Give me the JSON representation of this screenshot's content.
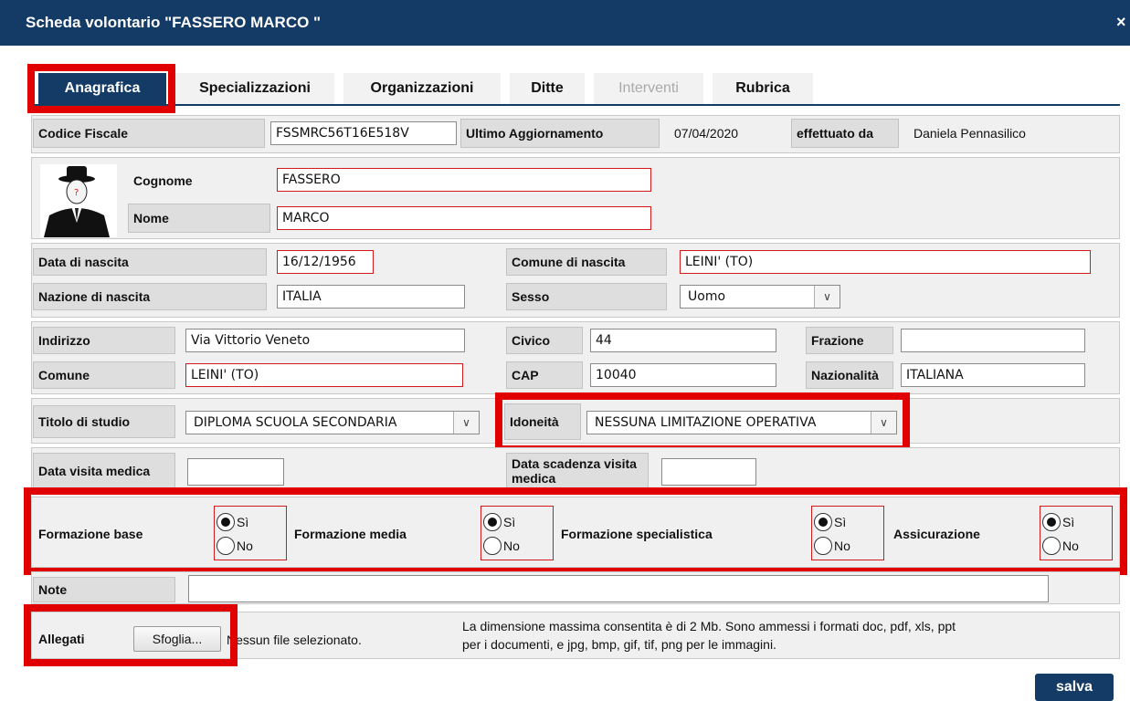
{
  "window": {
    "title": "Scheda volontario \"FASSERO MARCO \"",
    "close_label": "×"
  },
  "tabs": [
    {
      "label": "Anagrafica"
    },
    {
      "label": "Specializzazioni"
    },
    {
      "label": "Organizzazioni"
    },
    {
      "label": "Ditte"
    },
    {
      "label": "Interventi"
    },
    {
      "label": "Rubrica"
    }
  ],
  "header": {
    "codice_fiscale_label": "Codice Fiscale",
    "codice_fiscale_value": "FSSMRC56T16E518V",
    "ultimo_label": "Ultimo Aggiornamento",
    "ultimo_value": "07/04/2020",
    "effettuato_label": "effettuato da",
    "effettuato_value": "Daniela Pennasilico"
  },
  "person": {
    "cognome_label": "Cognome",
    "cognome_value": "FASSERO",
    "nome_label": "Nome",
    "nome_value": "MARCO"
  },
  "birth": {
    "data_label": "Data di nascita",
    "data_value": "16/12/1956",
    "comune_label": "Comune di nascita",
    "comune_value": "LEINI' (TO)",
    "nazione_label": "Nazione di nascita",
    "nazione_value": "ITALIA",
    "sesso_label": "Sesso",
    "sesso_value": "Uomo"
  },
  "address": {
    "indirizzo_label": "Indirizzo",
    "indirizzo_value": "Via Vittorio Veneto",
    "civico_label": "Civico",
    "civico_value": "44",
    "frazione_label": "Frazione",
    "frazione_value": "",
    "comune_label": "Comune",
    "comune_value": "LEINI' (TO)",
    "cap_label": "CAP",
    "cap_value": "10040",
    "nazionalita_label": "Nazionalità",
    "nazionalita_value": "ITALIANA"
  },
  "study": {
    "titolo_label": "Titolo di studio",
    "titolo_value": "DIPLOMA SCUOLA SECONDARIA",
    "idoneita_label": "Idoneità",
    "idoneita_value": "NESSUNA LIMITAZIONE OPERATIVA"
  },
  "medical": {
    "visita_label": "Data visita medica",
    "visita_value": "",
    "scadenza_label": "Data scadenza visita medica",
    "scadenza_value": ""
  },
  "training": {
    "yes_label": "Sì",
    "no_label": "No",
    "items": [
      {
        "label": "Formazione base",
        "selected": "Sì"
      },
      {
        "label": "Formazione media",
        "selected": "Sì"
      },
      {
        "label": "Formazione specialistica",
        "selected": "Sì"
      },
      {
        "label": "Assicurazione",
        "selected": "Sì"
      }
    ]
  },
  "note": {
    "label": "Note",
    "value": ""
  },
  "attachments": {
    "label": "Allegati",
    "browse_label": "Sfoglia...",
    "status": "Nessun file selezionato.",
    "info_line1": "La dimensione massima consentita è di 2 Mb. Sono ammessi i formati doc, pdf, xls, ppt",
    "info_line2": "per i documenti, e jpg, bmp, gif, tif, png per le immagini."
  },
  "actions": {
    "save_label": "salva"
  }
}
